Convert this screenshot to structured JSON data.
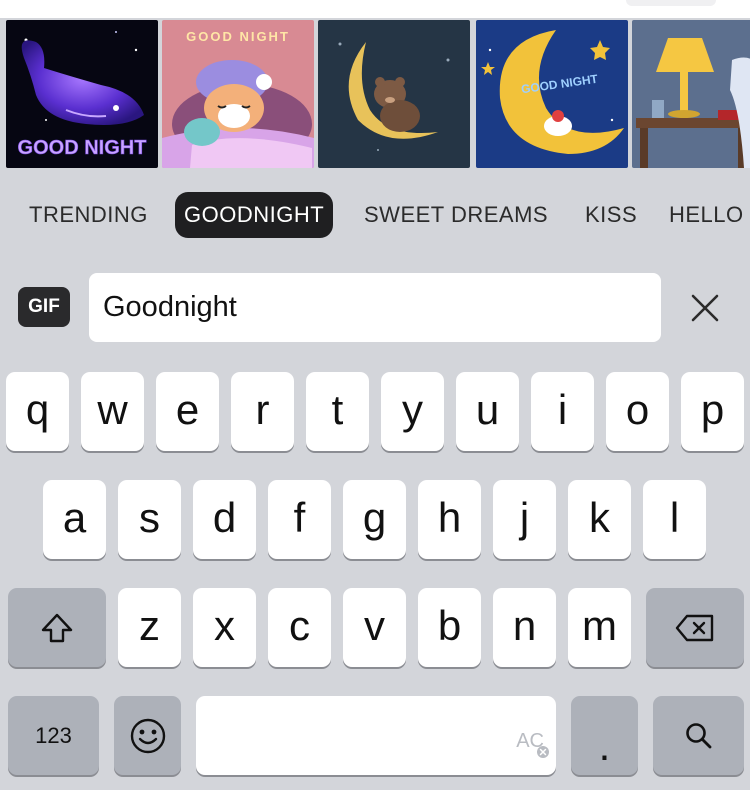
{
  "gifs": [
    {
      "name": "whale",
      "caption": "GOOD NIGHT"
    },
    {
      "name": "sleepy-bunny",
      "caption": "GOOD NIGHT"
    },
    {
      "name": "bear-moon",
      "caption": ""
    },
    {
      "name": "goodnight-moon",
      "caption": "GOOD NIGHT"
    },
    {
      "name": "lamp-nightstand",
      "caption": ""
    }
  ],
  "categories": [
    {
      "label": "TRENDING",
      "active": false
    },
    {
      "label": "GOODNIGHT",
      "active": true
    },
    {
      "label": "SWEET DREAMS",
      "active": false
    },
    {
      "label": "KISS",
      "active": false
    },
    {
      "label": "HELLO",
      "active": false
    }
  ],
  "search": {
    "badge": "GIF",
    "value": "Goodnight",
    "clear_icon": "close-icon"
  },
  "keyboard": {
    "row1": [
      "q",
      "w",
      "e",
      "r",
      "t",
      "y",
      "u",
      "i",
      "o",
      "p"
    ],
    "row2": [
      "a",
      "s",
      "d",
      "f",
      "g",
      "h",
      "j",
      "k",
      "l"
    ],
    "row3": [
      "z",
      "x",
      "c",
      "v",
      "b",
      "n",
      "m"
    ],
    "shift_icon": "shift-icon",
    "delete_icon": "backspace-icon",
    "numbers_label": "123",
    "emoji_icon": "emoji-icon",
    "space_badge": "AC",
    "period_label": ".",
    "search_icon": "search-icon"
  },
  "colors": {
    "keyboard_bg": "#d3d5da",
    "key_light": "#ffffff",
    "key_dark": "#adb1b9",
    "chip_active_bg": "#1f1f21"
  }
}
